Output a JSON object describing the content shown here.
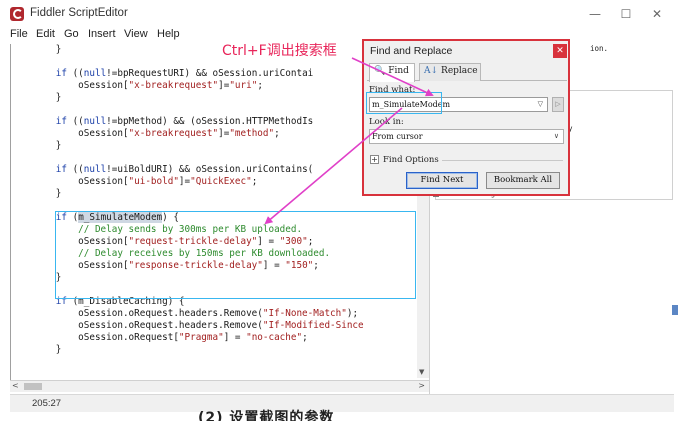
{
  "window": {
    "title": "Fiddler ScriptEditor",
    "controls": {
      "minimize": "—",
      "maximize": "☐",
      "close": "✕"
    }
  },
  "menu": [
    "File",
    "Edit",
    "Go",
    "Insert",
    "View",
    "Help"
  ],
  "code": {
    "lines": [
      [
        {
          "t": "        }",
          "c": ""
        }
      ],
      [
        {
          "t": "",
          "c": ""
        }
      ],
      [
        {
          "t": "        ",
          "c": ""
        },
        {
          "t": "if",
          "c": "kw"
        },
        {
          "t": " ((",
          "c": ""
        },
        {
          "t": "null",
          "c": "kw"
        },
        {
          "t": "!=bpRequestURI) && oSession.uriContai",
          "c": ""
        }
      ],
      [
        {
          "t": "            oSession[",
          "c": ""
        },
        {
          "t": "\"x-breakrequest\"",
          "c": "str"
        },
        {
          "t": "]=",
          "c": ""
        },
        {
          "t": "\"uri\"",
          "c": "str"
        },
        {
          "t": ";",
          "c": ""
        }
      ],
      [
        {
          "t": "        }",
          "c": ""
        }
      ],
      [
        {
          "t": "",
          "c": ""
        }
      ],
      [
        {
          "t": "        ",
          "c": ""
        },
        {
          "t": "if",
          "c": "kw"
        },
        {
          "t": " ((",
          "c": ""
        },
        {
          "t": "null",
          "c": "kw"
        },
        {
          "t": "!=bpMethod) && (oSession.HTTPMethodIs",
          "c": ""
        }
      ],
      [
        {
          "t": "            oSession[",
          "c": ""
        },
        {
          "t": "\"x-breakrequest\"",
          "c": "str"
        },
        {
          "t": "]=",
          "c": ""
        },
        {
          "t": "\"method\"",
          "c": "str"
        },
        {
          "t": ";",
          "c": ""
        }
      ],
      [
        {
          "t": "        }",
          "c": ""
        }
      ],
      [
        {
          "t": "",
          "c": ""
        }
      ],
      [
        {
          "t": "        ",
          "c": ""
        },
        {
          "t": "if",
          "c": "kw"
        },
        {
          "t": " ((",
          "c": ""
        },
        {
          "t": "null",
          "c": "kw"
        },
        {
          "t": "!=uiBoldURI) && oSession.uriContains(",
          "c": ""
        }
      ],
      [
        {
          "t": "            oSession[",
          "c": ""
        },
        {
          "t": "\"ui-bold\"",
          "c": "str"
        },
        {
          "t": "]=",
          "c": ""
        },
        {
          "t": "\"QuickExec\"",
          "c": "str"
        },
        {
          "t": ";",
          "c": ""
        }
      ],
      [
        {
          "t": "        }",
          "c": ""
        }
      ],
      [
        {
          "t": "",
          "c": ""
        }
      ],
      [
        {
          "t": "        ",
          "c": ""
        },
        {
          "t": "if",
          "c": "kw"
        },
        {
          "t": " (",
          "c": ""
        },
        {
          "t": "m_SimulateModem",
          "c": "sel"
        },
        {
          "t": ") {",
          "c": ""
        }
      ],
      [
        {
          "t": "            ",
          "c": ""
        },
        {
          "t": "// Delay sends by 300ms per KB uploaded.",
          "c": "com"
        }
      ],
      [
        {
          "t": "            oSession[",
          "c": ""
        },
        {
          "t": "\"request-trickle-delay\"",
          "c": "str"
        },
        {
          "t": "] = ",
          "c": ""
        },
        {
          "t": "\"300\"",
          "c": "str"
        },
        {
          "t": ";",
          "c": ""
        }
      ],
      [
        {
          "t": "            ",
          "c": ""
        },
        {
          "t": "// Delay receives by 150ms per KB downloaded.",
          "c": "com"
        }
      ],
      [
        {
          "t": "            oSession[",
          "c": ""
        },
        {
          "t": "\"response-trickle-delay\"",
          "c": "str"
        },
        {
          "t": "] = ",
          "c": ""
        },
        {
          "t": "\"150\"",
          "c": "str"
        },
        {
          "t": ";",
          "c": ""
        }
      ],
      [
        {
          "t": "        }",
          "c": ""
        }
      ],
      [
        {
          "t": "",
          "c": ""
        }
      ],
      [
        {
          "t": "        ",
          "c": ""
        },
        {
          "t": "if",
          "c": "kw"
        },
        {
          "t": " (m_DisableCaching) {",
          "c": ""
        }
      ],
      [
        {
          "t": "            oSession.oRequest.headers.Remove(",
          "c": ""
        },
        {
          "t": "\"If-None-Match\"",
          "c": "str"
        },
        {
          "t": ");",
          "c": ""
        }
      ],
      [
        {
          "t": "            oSession.oRequest.headers.Remove(",
          "c": ""
        },
        {
          "t": "\"If-Modified-Since",
          "c": "str"
        }
      ],
      [
        {
          "t": "            oSession.oRequest[",
          "c": ""
        },
        {
          "t": "\"Pragma\"",
          "c": "str"
        },
        {
          "t": "] = ",
          "c": ""
        },
        {
          "t": "\"no-cache\"",
          "c": "str"
        },
        {
          "t": ";",
          "c": ""
        }
      ],
      [
        {
          "t": "        }",
          "c": ""
        }
      ]
    ]
  },
  "status": {
    "position": "205:27"
  },
  "right_panel": {
    "fragment_top": "ion.",
    "fragment_mid": "y",
    "tree_item": "dentDataTrage."
  },
  "annotation": {
    "text": "Ctrl+F调出搜索框",
    "color": "#e8255a"
  },
  "caption": "(2) 设置截图的参数",
  "dialog": {
    "title": "Find and Replace",
    "close": "✕",
    "tabs": [
      {
        "label": "Find",
        "icon": "🔍"
      },
      {
        "label": "Replace",
        "icon": "A↓"
      }
    ],
    "find_what_label": "Find what:",
    "find_what_value": "m_SimulateModem",
    "look_in_label": "Look in:",
    "look_in_value": "From cursor",
    "find_options_label": "Find Options",
    "find_next": "Find Next",
    "bookmark_all": "Bookmark All"
  },
  "colors": {
    "accent": "#39b7f0",
    "annotation": "#e8255a",
    "dialog_border": "#d8323c"
  }
}
